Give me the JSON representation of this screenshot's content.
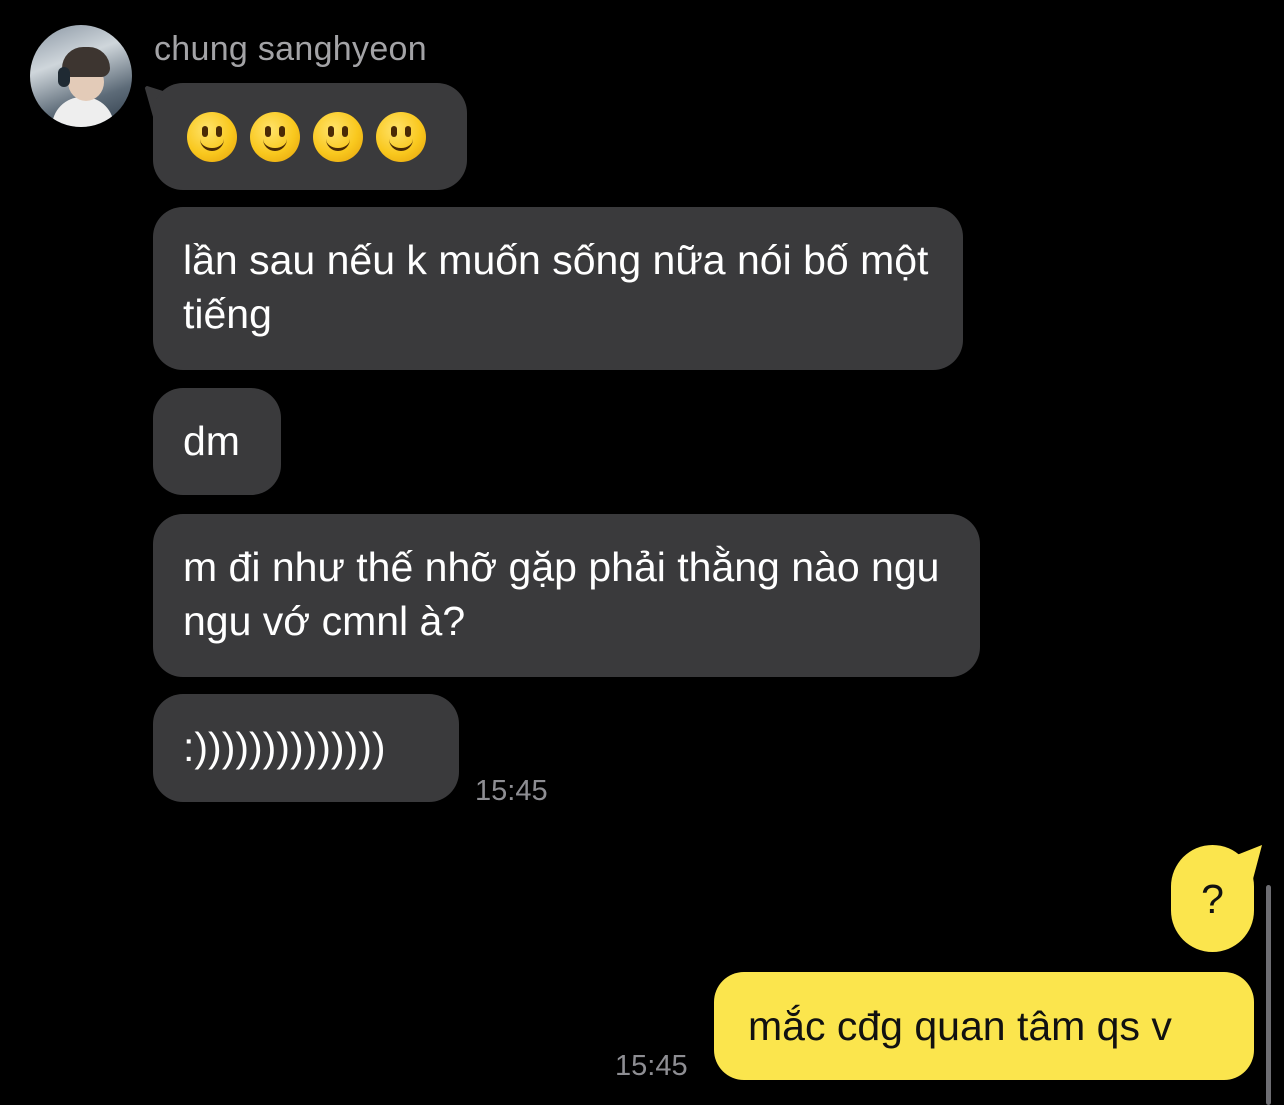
{
  "chat": {
    "sender_name": "chung sanghyeon",
    "incoming": [
      {
        "text": "🙂🙂🙂🙂",
        "emoji_icon": "slightly-smiling-face-icon",
        "emoji_count": 4
      },
      {
        "text": "lần sau nếu k muốn sống nữa nói bố một tiếng"
      },
      {
        "text": "dm"
      },
      {
        "text": "m đi như thế nhỡ gặp phải thằng nào ngu ngu vớ cmnl à?"
      },
      {
        "text": ":))))))))))))))"
      }
    ],
    "incoming_time": "15:45",
    "outgoing": [
      {
        "text": "?"
      },
      {
        "text": "mắc cđg quan tâm qs v"
      }
    ],
    "outgoing_time": "15:45"
  },
  "colors": {
    "background": "#000000",
    "incoming_bubble": "#3a3a3c",
    "outgoing_bubble": "#fbe54d",
    "timestamp": "#8e8e93",
    "sender_name": "#a3a3a6"
  }
}
